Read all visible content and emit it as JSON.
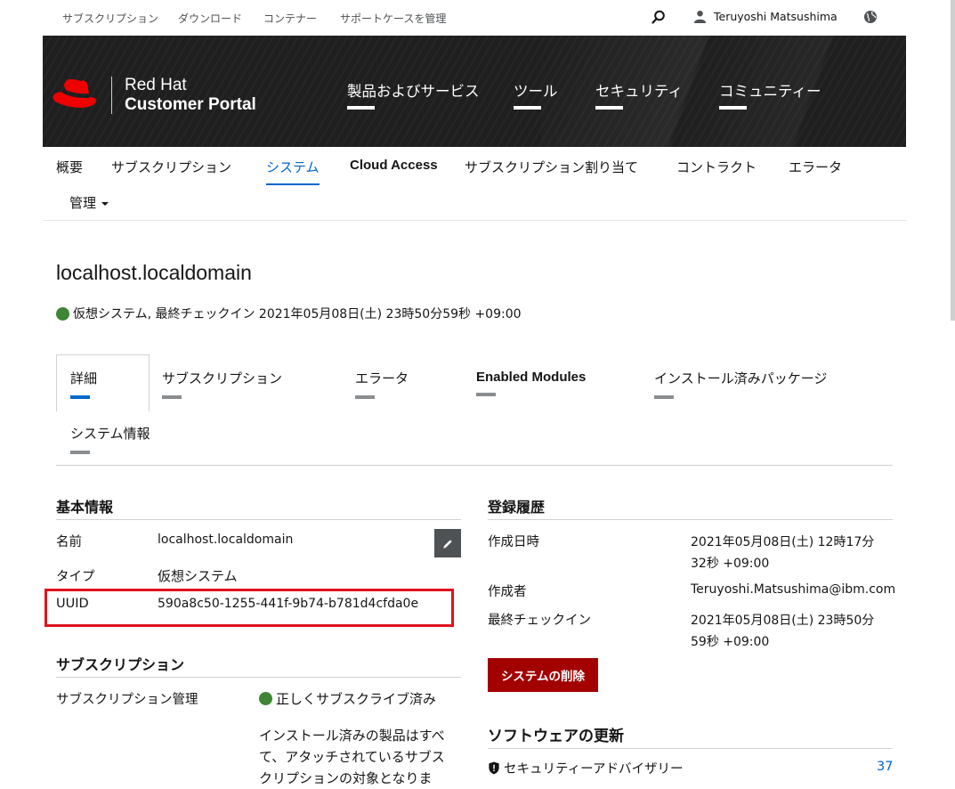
{
  "utility": {
    "links": [
      "サブスクリプション",
      "ダウンロード",
      "コンテナー",
      "サポートケースを管理"
    ],
    "user_name": "Teruyoshi Matsushima"
  },
  "masthead": {
    "logo_line1": "Red Hat",
    "logo_line2": "Customer Portal",
    "nav": [
      "製品およびサービス",
      "ツール",
      "セキュリティ",
      "コミュニティー"
    ],
    "brand_color": "#ee0000"
  },
  "subnav": {
    "items": [
      "概要",
      "サブスクリプション",
      "システム",
      "Cloud Access",
      "サブスクリプション割り当て",
      "コントラクト",
      "エラータ"
    ],
    "manage_label": "管理",
    "active": "システム"
  },
  "system": {
    "hostname": "localhost.localdomain",
    "status_text": "仮想システム, 最終チェックイン 2021年05月08日(土) 23時50分59秒 +09:00"
  },
  "tabs": [
    "詳細",
    "サブスクリプション",
    "エラータ",
    "Enabled Modules",
    "インストール済みパッケージ",
    "システム情報"
  ],
  "basic_info": {
    "heading": "基本情報",
    "name_label": "名前",
    "name_value": "localhost.localdomain",
    "type_label": "タイプ",
    "type_value": "仮想システム",
    "uuid_label": "UUID",
    "uuid_value": "590a8c50-1255-441f-9b74-b781d4cfda0e"
  },
  "subscription": {
    "heading": "サブスクリプション",
    "mgmt_label": "サブスクリプション管理",
    "status": "正しくサブスクライブ済み",
    "desc_line1": "インストール済みの製品はすべ",
    "desc_line2": "て、アタッチされているサブス",
    "desc_line3": "クリプションの対象となりま"
  },
  "history": {
    "heading": "登録履歴",
    "created_label": "作成日時",
    "created_line1": "2021年05月08日(土) 12時17分",
    "created_line2": "32秒 +09:00",
    "creator_label": "作成者",
    "creator_value": "Teruyoshi.Matsushima@ibm.com",
    "checkin_label": "最終チェックイン",
    "checkin_line1": "2021年05月08日(土) 23時50分",
    "checkin_line2": "59秒 +09:00",
    "delete_label": "システムの削除"
  },
  "software_updates": {
    "heading": "ソフトウェアの更新",
    "security_label": "セキュリティーアドバイザリー",
    "security_count": "37"
  }
}
